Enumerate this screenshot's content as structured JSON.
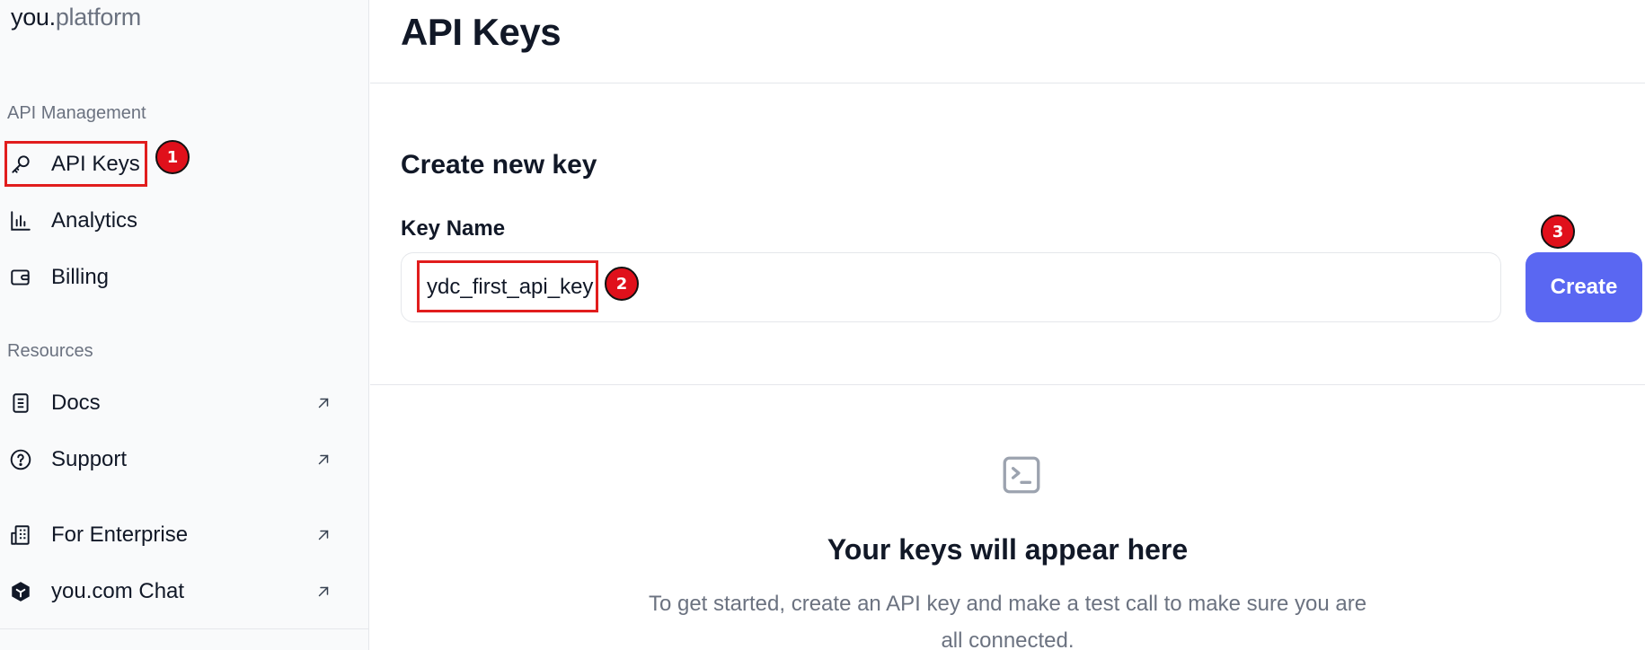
{
  "brand": {
    "primary": "you.",
    "secondary": "platform"
  },
  "sidebar": {
    "sections": [
      {
        "label": "API Management"
      },
      {
        "label": "Resources"
      }
    ],
    "items": [
      {
        "label": "API Keys",
        "icon": "key-icon"
      },
      {
        "label": "Analytics",
        "icon": "bar-chart-icon"
      },
      {
        "label": "Billing",
        "icon": "wallet-icon"
      },
      {
        "label": "Docs",
        "icon": "document-icon",
        "external": true
      },
      {
        "label": "Support",
        "icon": "help-circle-icon",
        "external": true
      },
      {
        "label": "For Enterprise",
        "icon": "building-icon",
        "external": true
      },
      {
        "label": "you.com Chat",
        "icon": "you-logo-icon",
        "external": true
      }
    ]
  },
  "main": {
    "title": "API Keys",
    "create": {
      "heading": "Create new key",
      "field_label": "Key Name",
      "field_value": "ydc_first_api_key",
      "button_label": "Create"
    },
    "empty_state": {
      "icon": "terminal-icon",
      "title": "Your keys will appear here",
      "description_line1": "To get started, create an API key and make a test call to make sure you are",
      "description_line2": "all connected."
    }
  },
  "annotations": {
    "badges": [
      "1",
      "2",
      "3"
    ]
  },
  "colors": {
    "accent": "#5a67f2",
    "highlight": "#e11d1d"
  }
}
